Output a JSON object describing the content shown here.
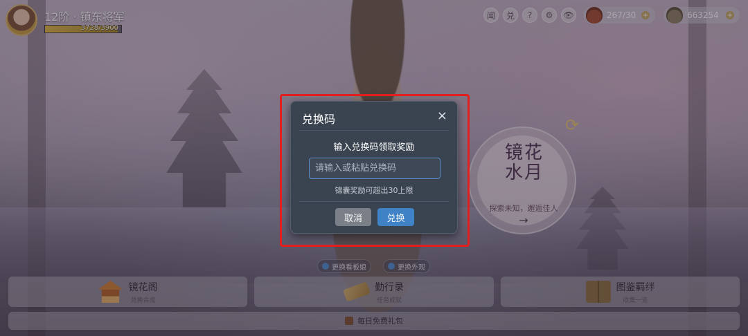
{
  "player": {
    "rank_title": "12阶 · 镇东将军",
    "xp_current": 3728,
    "xp_max": 3900,
    "xp_text": "3728/3900"
  },
  "top_bar": {
    "icons": [
      {
        "name": "news",
        "label": "闻"
      },
      {
        "name": "redeem",
        "label": "兑"
      },
      {
        "name": "help",
        "label": "?"
      },
      {
        "name": "settings",
        "label": "⚙"
      },
      {
        "name": "view",
        "label": "👁"
      }
    ],
    "stamina_text": "267/30",
    "coins_text": "663254"
  },
  "side_feature": {
    "title_line1": "镜花",
    "title_line2": "水月",
    "subtitle": "探索未知，邂逅佳人",
    "arrow": "→"
  },
  "mini_buttons": {
    "left": "更换看板娘",
    "right": "更换外观"
  },
  "bottom_menu": [
    {
      "title": "镜花阁",
      "sub": "兑换合成"
    },
    {
      "title": "勤行录",
      "sub": "任务成就"
    },
    {
      "title": "图鉴羁绊",
      "sub": "收集一览"
    }
  ],
  "gift_bar": {
    "label": "每日免费礼包"
  },
  "modal": {
    "title": "兑换码",
    "close_glyph": "×",
    "prompt": "输入兑换码领取奖励",
    "input_value": "",
    "input_placeholder": "请输入或粘贴兑换码",
    "note": "锦囊奖励可超出30上限",
    "cancel_label": "取消",
    "confirm_label": "兑换"
  },
  "colors": {
    "modal_bg": "#3a4350",
    "confirm_blue": "#3f82c6",
    "highlight_red": "#e21e1e"
  }
}
